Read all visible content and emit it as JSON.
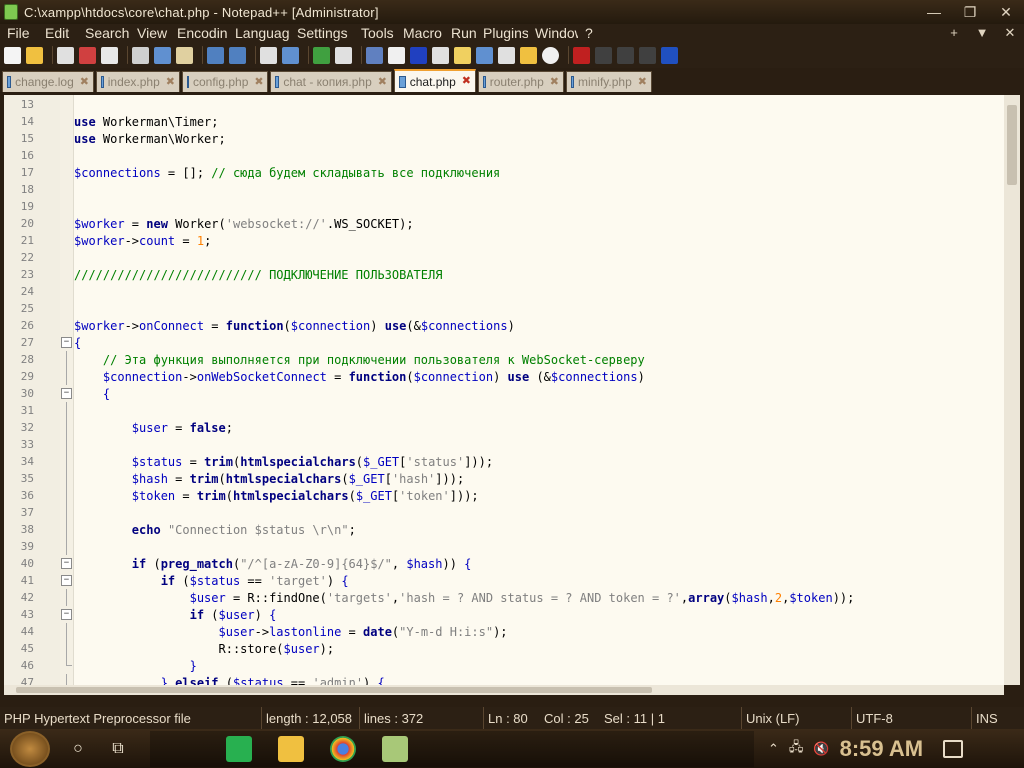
{
  "window": {
    "title": "C:\\xampp\\htdocs\\core\\chat.php - Notepad++ [Administrator]",
    "controls": [
      "—",
      "❐",
      "✕"
    ]
  },
  "menu": {
    "items": [
      "File",
      "Edit",
      "Search",
      "View",
      "Encoding",
      "Language",
      "Settings",
      "Tools",
      "Macro",
      "Run",
      "Plugins",
      "Window",
      "?"
    ],
    "right_controls": [
      "+",
      "▼",
      "✕"
    ]
  },
  "tabs": [
    {
      "label": "change.log",
      "active": false
    },
    {
      "label": "index.php",
      "active": false
    },
    {
      "label": "config.php",
      "active": false
    },
    {
      "label": "chat - копия.php",
      "active": false
    },
    {
      "label": "chat.php",
      "active": true
    },
    {
      "label": "router.php",
      "active": false
    },
    {
      "label": "minify.php",
      "active": false
    }
  ],
  "editor": {
    "lines": [
      {
        "n": "13",
        "fold": "none",
        "html": ""
      },
      {
        "n": "14",
        "fold": "none",
        "html": "<span class='kw'>use</span> Workerman\\Timer;"
      },
      {
        "n": "15",
        "fold": "none",
        "html": "<span class='kw'>use</span> Workerman\\Worker;"
      },
      {
        "n": "16",
        "fold": "none",
        "html": ""
      },
      {
        "n": "17",
        "fold": "none",
        "html": "<span class='var'>$connections</span> = []; <span class='cmt'>// сюда будем складывать все подключения</span>"
      },
      {
        "n": "18",
        "fold": "none",
        "html": ""
      },
      {
        "n": "19",
        "fold": "none",
        "html": ""
      },
      {
        "n": "20",
        "fold": "none",
        "html": "<span class='var'>$worker</span> = <span class='kw'>new</span> Worker(<span class='str'>'websocket://'</span>.WS_SOCKET);"
      },
      {
        "n": "21",
        "fold": "none",
        "html": "<span class='var'>$worker</span>-><span class='var'>count</span> = <span class='num'>1</span>;"
      },
      {
        "n": "22",
        "fold": "none",
        "html": ""
      },
      {
        "n": "23",
        "fold": "none",
        "html": "<span class='cmt'>////////////////////////// ПОДКЛЮЧЕНИЕ ПОЛЬЗОВАТЕЛЯ</span>"
      },
      {
        "n": "24",
        "fold": "none",
        "html": ""
      },
      {
        "n": "25",
        "fold": "none",
        "html": ""
      },
      {
        "n": "26",
        "fold": "none",
        "html": "<span class='var'>$worker</span>-><span class='var'>onConnect</span> = <span class='kw'>function</span>(<span class='var'>$connection</span>) <span class='kw'>use</span>(&amp;<span class='var'>$connections</span>)"
      },
      {
        "n": "27",
        "fold": "open",
        "html": "<span class='var'>{</span>"
      },
      {
        "n": "28",
        "fold": "line",
        "html": "    <span class='cmt'>// Эта функция выполняется при подключении пользователя к WebSocket-серверу</span>"
      },
      {
        "n": "29",
        "fold": "line",
        "html": "    <span class='var'>$connection</span>-><span class='var'>onWebSocketConnect</span> = <span class='kw'>function</span>(<span class='var'>$connection</span>) <span class='kw'>use</span> (&amp;<span class='var'>$connections</span>)"
      },
      {
        "n": "30",
        "fold": "open",
        "html": "    <span class='var'>{</span>"
      },
      {
        "n": "31",
        "fold": "line",
        "html": ""
      },
      {
        "n": "32",
        "fold": "line",
        "html": "        <span class='var'>$user</span> = <span class='kw'>false</span>;"
      },
      {
        "n": "33",
        "fold": "line",
        "html": ""
      },
      {
        "n": "34",
        "fold": "line",
        "html": "        <span class='var'>$status</span> = <span class='fn'>trim</span>(<span class='fn'>htmlspecialchars</span>(<span class='var'>$_GET</span>[<span class='str'>'status'</span>]));"
      },
      {
        "n": "35",
        "fold": "line",
        "html": "        <span class='var'>$hash</span> = <span class='fn'>trim</span>(<span class='fn'>htmlspecialchars</span>(<span class='var'>$_GET</span>[<span class='str'>'hash'</span>]));"
      },
      {
        "n": "36",
        "fold": "line",
        "html": "        <span class='var'>$token</span> = <span class='fn'>trim</span>(<span class='fn'>htmlspecialchars</span>(<span class='var'>$_GET</span>[<span class='str'>'token'</span>]));"
      },
      {
        "n": "37",
        "fold": "line",
        "html": ""
      },
      {
        "n": "38",
        "fold": "line",
        "html": "        <span class='kw'>echo</span> <span class='str'>\"Connection $status \\r\\n\"</span>;"
      },
      {
        "n": "39",
        "fold": "line",
        "html": ""
      },
      {
        "n": "40",
        "fold": "open",
        "html": "        <span class='kw'>if</span> (<span class='fn'>preg_match</span>(<span class='str'>\"/^[a-zA-Z0-9]{64}$/\"</span>, <span class='var'>$hash</span>)) <span class='var'>{</span>"
      },
      {
        "n": "41",
        "fold": "open",
        "html": "            <span class='kw'>if</span> (<span class='var'>$status</span> == <span class='str'>'target'</span>) <span class='var'>{</span>"
      },
      {
        "n": "42",
        "fold": "line",
        "html": "                <span class='var'>$user</span> = R::findOne(<span class='str'>'targets'</span>,<span class='str'>'hash = ? AND status = ? AND token = ?'</span>,<span class='fn'>array</span>(<span class='var'>$hash</span>,<span class='num'>2</span>,<span class='var'>$token</span>));"
      },
      {
        "n": "43",
        "fold": "open",
        "html": "                <span class='kw'>if</span> (<span class='var'>$user</span>) <span class='var'>{</span>"
      },
      {
        "n": "44",
        "fold": "line",
        "html": "                    <span class='var'>$user</span>-><span class='var'>lastonline</span> = <span class='fn'>date</span>(<span class='str'>\"Y-m-d H:i:s\"</span>);"
      },
      {
        "n": "45",
        "fold": "line",
        "html": "                    R::store(<span class='var'>$user</span>);"
      },
      {
        "n": "46",
        "fold": "end",
        "html": "                <span class='var'>}</span>"
      },
      {
        "n": "47",
        "fold": "line",
        "html": "            <span class='var'>}</span> <span class='kw'>elseif</span> (<span class='var'>$status</span> == <span class='str'>'admin'</span>) <span class='var'>{</span>"
      }
    ]
  },
  "status": {
    "filetype": "PHP Hypertext Preprocessor file",
    "length": "length : 12,058",
    "lines": "lines : 372",
    "ln": "Ln : 80",
    "col": "Col : 25",
    "sel": "Sel : 11 | 1",
    "eol": "Unix (LF)",
    "encoding": "UTF-8",
    "mode": "INS"
  },
  "taskbar": {
    "clock": "8:59 AM"
  }
}
